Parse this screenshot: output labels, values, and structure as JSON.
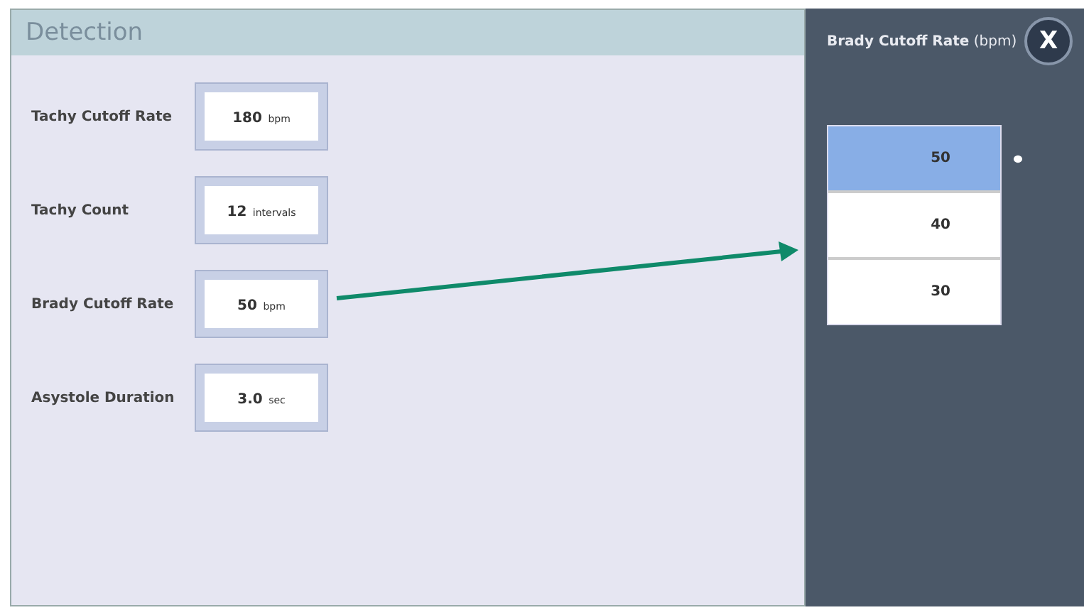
{
  "panel": {
    "title": "Detection"
  },
  "settings": [
    {
      "label": "Tachy Cutoff Rate",
      "value": "180",
      "unit": "bpm"
    },
    {
      "label": "Tachy Count",
      "value": "12",
      "unit": "intervals"
    },
    {
      "label": "Brady Cutoff Rate",
      "value": "50",
      "unit": "bpm"
    },
    {
      "label": "Asystole Duration",
      "value": "3.0",
      "unit": "sec"
    }
  ],
  "picker": {
    "title": "Brady Cutoff Rate",
    "unit": "(bpm)",
    "close": "X",
    "options": [
      {
        "label": "50",
        "selected": true
      },
      {
        "label": "40",
        "selected": false
      },
      {
        "label": "30",
        "selected": false
      }
    ]
  }
}
